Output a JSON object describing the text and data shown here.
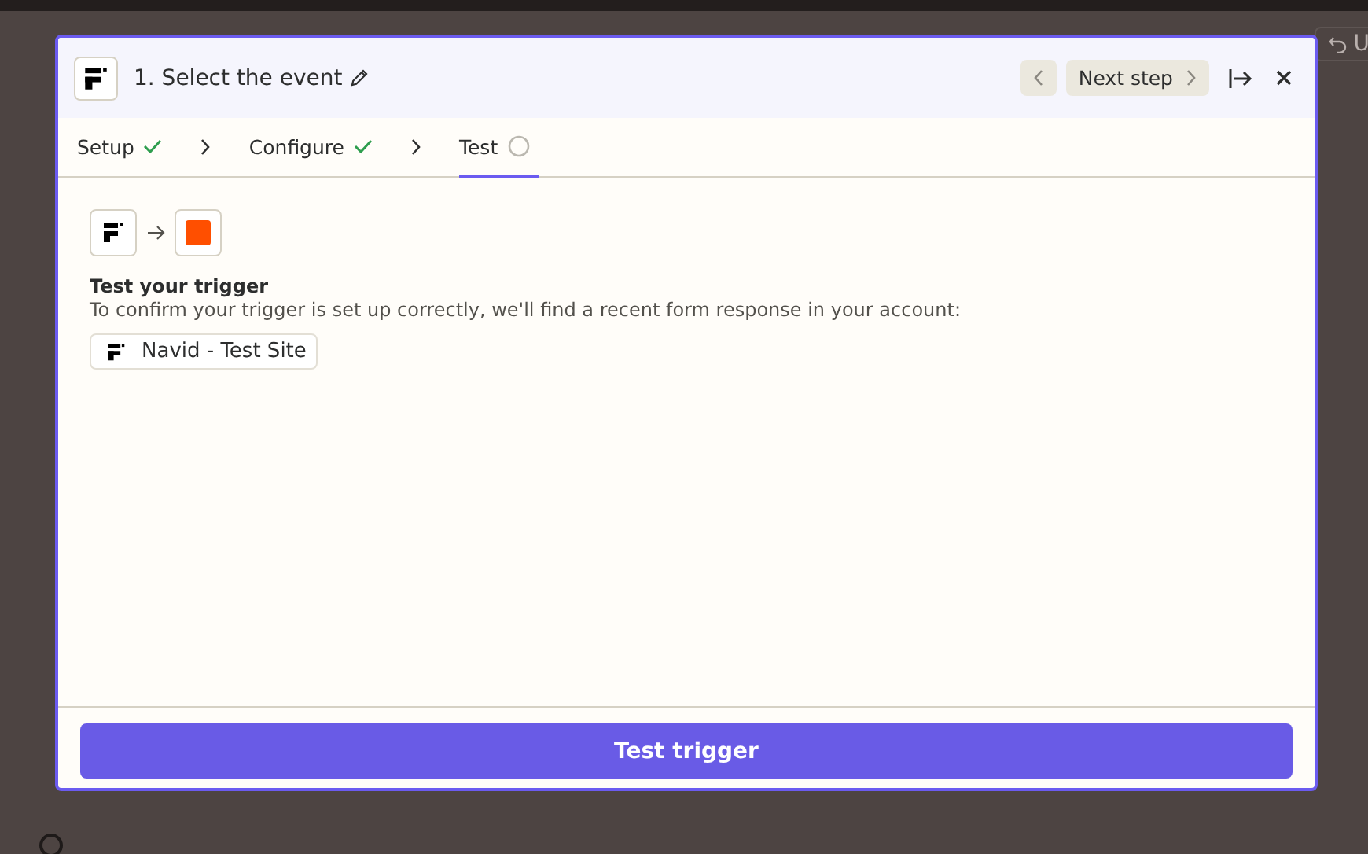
{
  "background": {
    "toolbar_button": "U"
  },
  "modal": {
    "title": "1. Select the event",
    "nav": {
      "prev_disabled": true,
      "next": "Next step"
    },
    "steps": [
      {
        "label": "Setup",
        "completed": true,
        "selected": false
      },
      {
        "label": "Configure",
        "completed": true,
        "selected": false
      },
      {
        "label": "Test",
        "completed": false,
        "selected": true
      }
    ],
    "body": {
      "heading": "Test your trigger",
      "description": "To confirm your trigger is set up correctly, we'll find a recent form response in your account:",
      "account": "Navid - Test Site"
    },
    "footer": {
      "button": "Test trigger"
    }
  }
}
